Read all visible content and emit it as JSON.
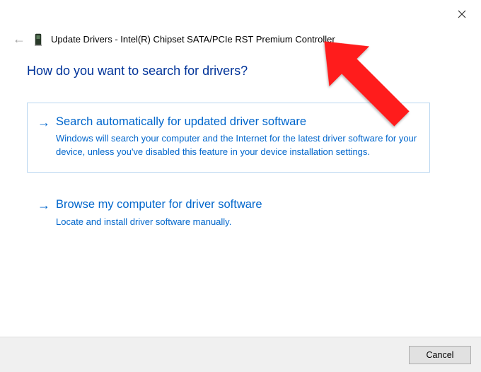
{
  "window": {
    "title_prefix": "Update Drivers",
    "device_name": "Intel(R) Chipset SATA/PCIe RST Premium Controller"
  },
  "question": "How do you want to search for drivers?",
  "options": [
    {
      "title": "Search automatically for updated driver software",
      "description": "Windows will search your computer and the Internet for the latest driver software for your device, unless you've disabled this feature in your device installation settings."
    },
    {
      "title": "Browse my computer for driver software",
      "description": "Locate and install driver software manually."
    }
  ],
  "buttons": {
    "cancel": "Cancel"
  }
}
